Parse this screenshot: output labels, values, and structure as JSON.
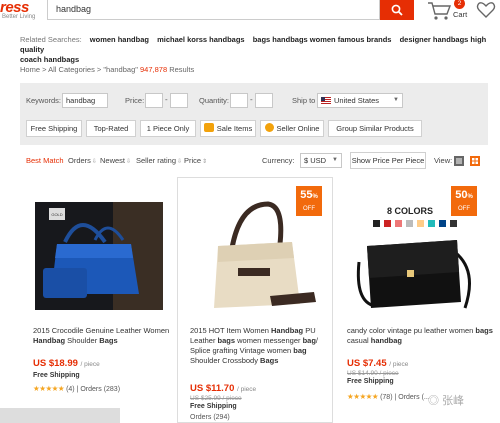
{
  "header": {
    "logo": "ress",
    "logo_tag": "Better Living",
    "search_value": "handbag",
    "cart_count": "2",
    "cart_label": "Cart"
  },
  "related": {
    "label": "Related Searches:",
    "items": [
      "women handbag",
      "michael korss handbags",
      "bags handbags women famous brands",
      "designer handbags high quality",
      "coach handbags"
    ]
  },
  "breadcrumb": {
    "path": "Home > All Categories > \"handbag\"",
    "count": "947,878",
    "suffix": "Results"
  },
  "filters": {
    "keywords_label": "Keywords:",
    "keywords_value": "handbag",
    "price_label": "Price:",
    "quantity_label": "Quantity:",
    "ship_label": "Ship to",
    "ship_value": "United States",
    "buttons": [
      "Free Shipping",
      "Top-Rated",
      "1 Piece Only",
      "Sale Items",
      "Seller Online",
      "Group Similar Products"
    ]
  },
  "sortbar": {
    "best_match": "Best Match",
    "orders": "Orders",
    "newest": "Newest",
    "seller_rating": "Seller rating",
    "price": "Price",
    "currency_label": "Currency:",
    "currency_value": "$ USD",
    "show_price": "Show Price Per Piece",
    "view_label": "View:"
  },
  "products": [
    {
      "title_parts": [
        "2015 Crocodile Genuine Leather Women ",
        "Handbag",
        " Shoulder ",
        "Bags"
      ],
      "price": "US $18.99",
      "per": "/ piece",
      "shipping": "Free Shipping",
      "rating_count": "(4)",
      "orders": "| Orders (283)"
    },
    {
      "title_parts": [
        "2015 HOT Item Women ",
        "Handbag",
        " PU Leather ",
        "bags",
        " women messenger ",
        "bag",
        "/ Splice grafting Vintage women ",
        "bag",
        " Shoulder Crossbody ",
        "Bags"
      ],
      "price": "US $11.70",
      "per": "/ piece",
      "old_price": "US $25.99 / piece",
      "shipping": "Free Shipping",
      "orders": "Orders (294)",
      "discount": "55",
      "discount_unit": "%",
      "discount_off": "OFF"
    },
    {
      "title_parts": [
        "candy color vintage pu leather women ",
        "bags",
        " casual ",
        "handbag"
      ],
      "price": "US $7.45",
      "per": "/ piece",
      "old_price": "US $14.90 / piece",
      "shipping": "Free Shipping",
      "rating_count": "(78)",
      "orders": "| Orders (...",
      "discount": "50",
      "discount_unit": "%",
      "discount_off": "OFF",
      "image_label": "8 COLORS"
    }
  ],
  "watermark": "张峰",
  "colors": {
    "accent": "#e62e04",
    "discount": "#f26a0c",
    "star": "#f5a623"
  }
}
